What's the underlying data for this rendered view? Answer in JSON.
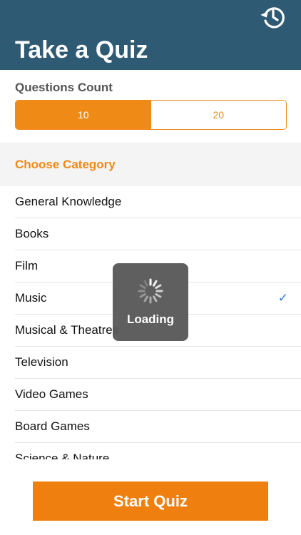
{
  "header": {
    "title": "Take a Quiz",
    "history_icon": "history-icon"
  },
  "questions_count": {
    "label": "Questions Count",
    "options": [
      "10",
      "20"
    ],
    "selected": "10"
  },
  "category": {
    "header": "Choose Category",
    "items": [
      {
        "label": "General Knowledge",
        "selected": false
      },
      {
        "label": "Books",
        "selected": false
      },
      {
        "label": "Film",
        "selected": false
      },
      {
        "label": "Music",
        "selected": true,
        "check": "✓"
      },
      {
        "label": "Musical & Theatres",
        "selected": false
      },
      {
        "label": "Television",
        "selected": false
      },
      {
        "label": "Video Games",
        "selected": false
      },
      {
        "label": "Board Games",
        "selected": false
      },
      {
        "label": "Science & Nature",
        "selected": false
      }
    ]
  },
  "loading": {
    "text": "Loading"
  },
  "start_button": {
    "label": "Start Quiz"
  },
  "colors": {
    "header_bg": "#2f5a73",
    "accent": "#ef8a17",
    "check": "#2f79d6"
  }
}
